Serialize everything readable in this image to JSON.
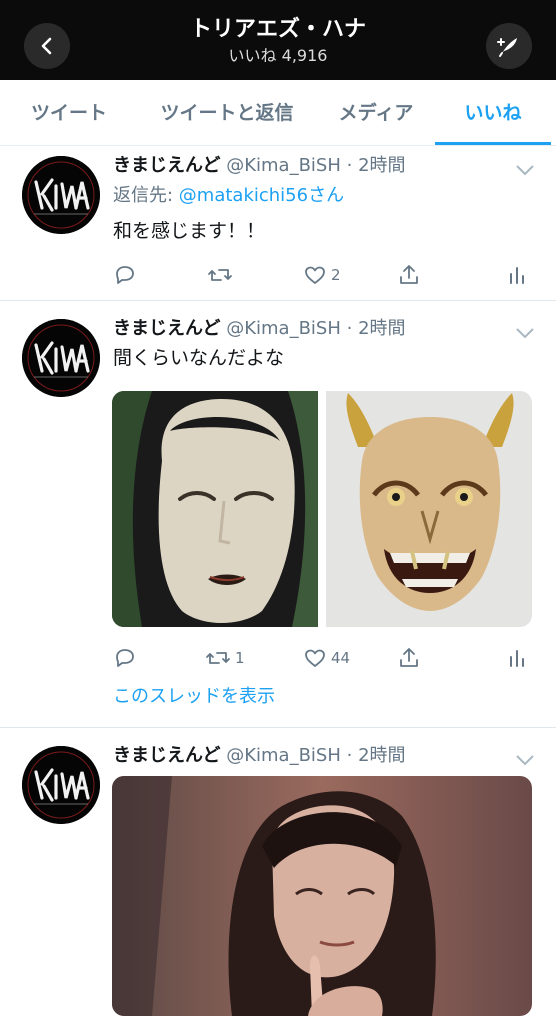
{
  "header": {
    "title": "トリアエズ・ハナ",
    "likes_label": "いいね",
    "likes_count": "4,916"
  },
  "tabs": [
    {
      "label": "ツイート",
      "active": false
    },
    {
      "label": "ツイートと返信",
      "active": false
    },
    {
      "label": "メディア",
      "active": false
    },
    {
      "label": "いいね",
      "active": true
    }
  ],
  "colors": {
    "accent": "#1da1f2",
    "header_bg": "#0b0b0b",
    "muted": "#657786"
  },
  "tweets": [
    {
      "name": "きまじえんど",
      "handle": "@Kima_BiSH",
      "time": "· 2時間",
      "reply_prefix": "返信先: ",
      "reply_mention": "@matakichi56さん",
      "text": "和を感じます！！",
      "actions": {
        "reply": "",
        "retweet": "",
        "like": "2",
        "share": ""
      }
    },
    {
      "name": "きまじえんど",
      "handle": "@Kima_BiSH",
      "time": "· 2時間",
      "text": "間くらいなんだよな",
      "actions": {
        "reply": "",
        "retweet": "1",
        "like": "44",
        "share": ""
      },
      "thread_link": "このスレッドを表示"
    },
    {
      "name": "きまじえんど",
      "handle": "@Kima_BiSH",
      "time": "· 2時間"
    }
  ],
  "icons": {
    "back": "chevron-left-icon",
    "compose": "compose-tweet-icon",
    "reply": "reply-icon",
    "retweet": "retweet-icon",
    "like": "heart-icon",
    "share": "share-icon",
    "analytics": "analytics-icon",
    "caret": "chevron-down-icon"
  }
}
